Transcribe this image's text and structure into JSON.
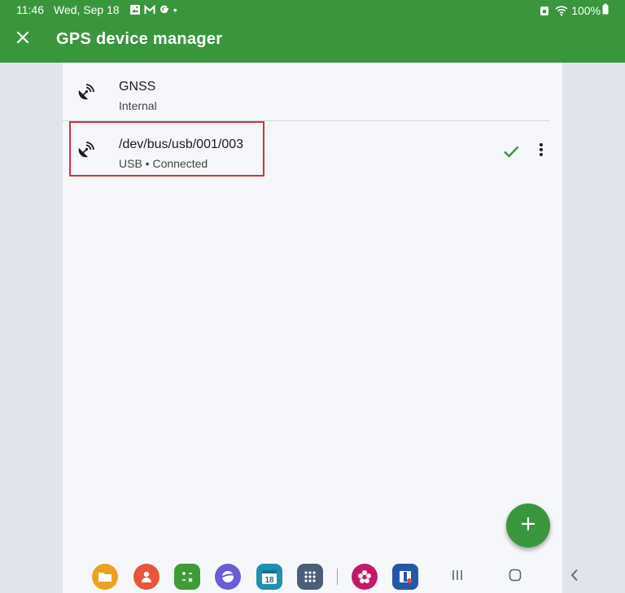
{
  "status_bar": {
    "time": "11:46",
    "date": "Wed, Sep 18",
    "notification_icons": [
      "image-icon",
      "gmail-icon",
      "google-icon"
    ],
    "more_dot": "•",
    "battery": "100%"
  },
  "app_bar": {
    "title": "GPS device manager",
    "close_icon": "close-icon"
  },
  "devices": [
    {
      "name": "GNSS",
      "subtitle": "Internal",
      "icon": "satellite-icon"
    },
    {
      "name": "/dev/bus/usb/001/003",
      "subtitle": "USB • Connected",
      "icon": "satellite-icon",
      "connected": true
    }
  ],
  "fab": {
    "icon": "plus-icon"
  },
  "taskbar": {
    "apps": [
      "my-files",
      "contacts",
      "calculator",
      "samsung-internet",
      "calendar",
      "apps-grid",
      "blossom-app",
      "book-app"
    ],
    "calendar_day": "18"
  },
  "colors": {
    "primary": "#3a963d",
    "highlight": "#d0343c",
    "panel": "#f6f7fa",
    "background": "#e1e4ec"
  }
}
